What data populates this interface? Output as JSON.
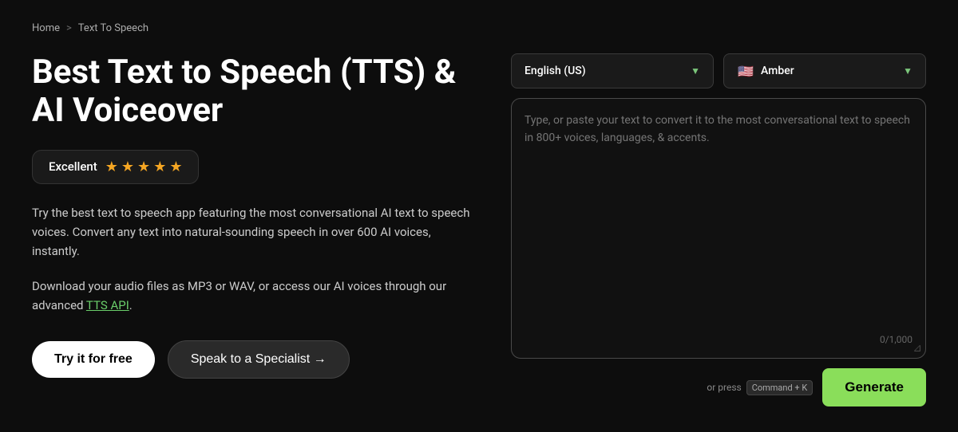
{
  "breadcrumb": {
    "home": "Home",
    "separator": ">",
    "current": "Text To Speech"
  },
  "hero": {
    "headline": "Best Text to Speech (TTS) & AI Voiceover",
    "rating": {
      "label": "Excellent",
      "stars": [
        "★",
        "★",
        "★",
        "★",
        "★"
      ]
    },
    "description1": "Try the best text to speech app featuring the most conversational AI text to speech voices. Convert any text into natural-sounding speech in over 600 AI voices, instantly.",
    "description2_prefix": "Download your audio files as MP3 or WAV, or access our AI voices through our advanced ",
    "description2_link": "TTS API",
    "description2_suffix": ".",
    "buttons": {
      "try": "Try it for free",
      "specialist": "Speak to a Specialist →"
    }
  },
  "tts_tool": {
    "language_dropdown": {
      "label": "English (US)",
      "arrow": "▼"
    },
    "voice_dropdown": {
      "flag": "🇺🇸",
      "name": "Amber",
      "arrow": "▼"
    },
    "textarea": {
      "placeholder": "Type, or paste your text to convert it to the most conversational text to speech in 800+ voices, languages, & accents.",
      "char_count": "0/1,000"
    },
    "generate_button": "Generate",
    "keyboard_hint_prefix": "or press",
    "keyboard_hint_key": "Command + K"
  }
}
